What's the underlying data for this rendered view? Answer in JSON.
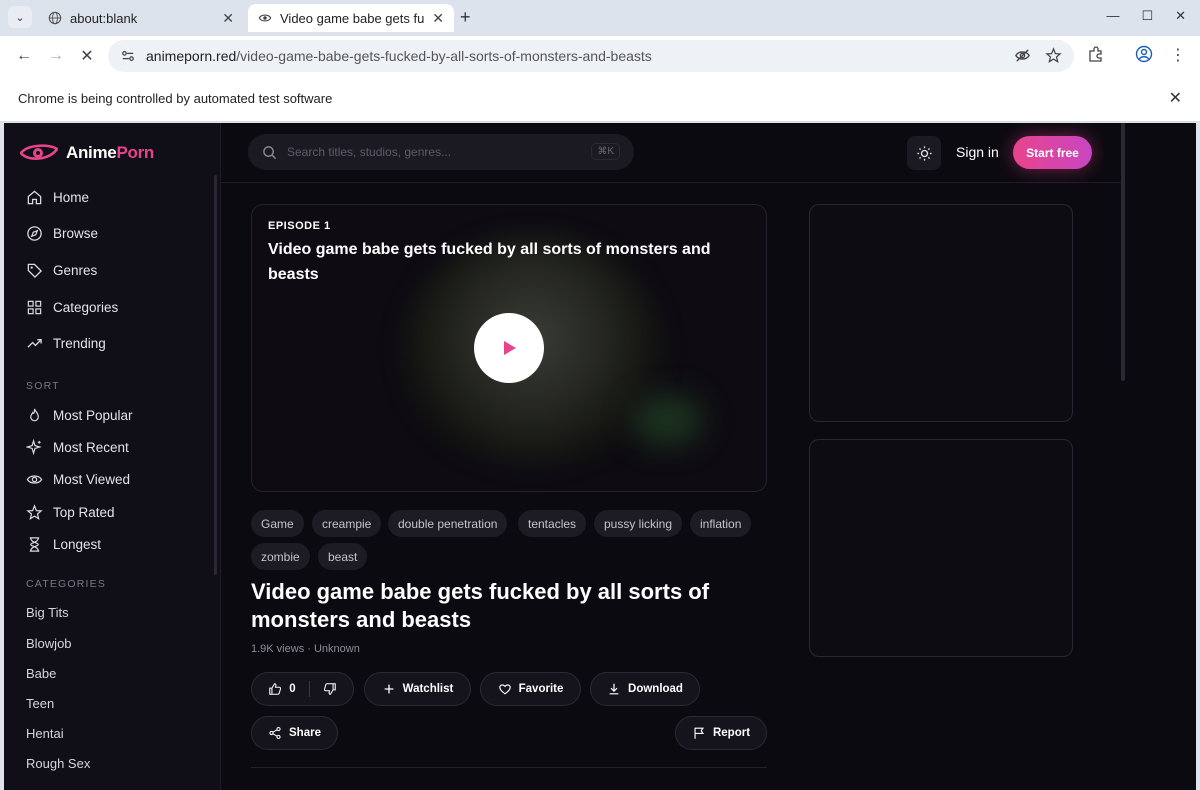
{
  "browser": {
    "tabs": [
      {
        "title": "about:blank"
      },
      {
        "title": "Video game babe gets fu"
      }
    ],
    "url_domain": "animeporn.red",
    "url_path": "/video-game-babe-gets-fucked-by-all-sorts-of-monsters-and-beasts",
    "automation_message": "Chrome is being controlled by automated test software"
  },
  "site": {
    "brand_part1": "Anime",
    "brand_part2": "Porn",
    "accent_color": "#e8448c",
    "search_placeholder": "Search titles, studios, genres...",
    "search_shortcut": "⌘K",
    "sign_in": "Sign in",
    "start_free": "Start free"
  },
  "sidebar": {
    "nav": [
      {
        "label": "Home",
        "icon": "home-icon"
      },
      {
        "label": "Browse",
        "icon": "compass-icon"
      },
      {
        "label": "Genres",
        "icon": "tag-icon"
      },
      {
        "label": "Categories",
        "icon": "grid-icon"
      },
      {
        "label": "Trending",
        "icon": "trending-icon"
      }
    ],
    "sort_label": "SORT",
    "sort": [
      {
        "label": "Most Popular",
        "icon": "flame-icon"
      },
      {
        "label": "Most Recent",
        "icon": "sparkle-icon"
      },
      {
        "label": "Most Viewed",
        "icon": "eye-icon"
      },
      {
        "label": "Top Rated",
        "icon": "star-icon"
      },
      {
        "label": "Longest",
        "icon": "hourglass-icon"
      }
    ],
    "categories_label": "CATEGORIES",
    "categories": [
      "Big Tits",
      "Blowjob",
      "Babe",
      "Teen",
      "Hentai",
      "Rough Sex"
    ]
  },
  "player": {
    "episode_label": "EPISODE 1",
    "title": "Video game babe gets fucked by all sorts of monsters and beasts"
  },
  "tags": [
    "Game",
    "creampie",
    "double penetration",
    "tentacles",
    "pussy licking",
    "inflation",
    "zombie",
    "beast"
  ],
  "video": {
    "title": "Video game babe gets fucked by all sorts of monsters and beasts",
    "meta": "1.9K views · Unknown",
    "likes": "0",
    "watchlist": "Watchlist",
    "favorite": "Favorite",
    "download": "Download",
    "share": "Share",
    "report": "Report"
  }
}
